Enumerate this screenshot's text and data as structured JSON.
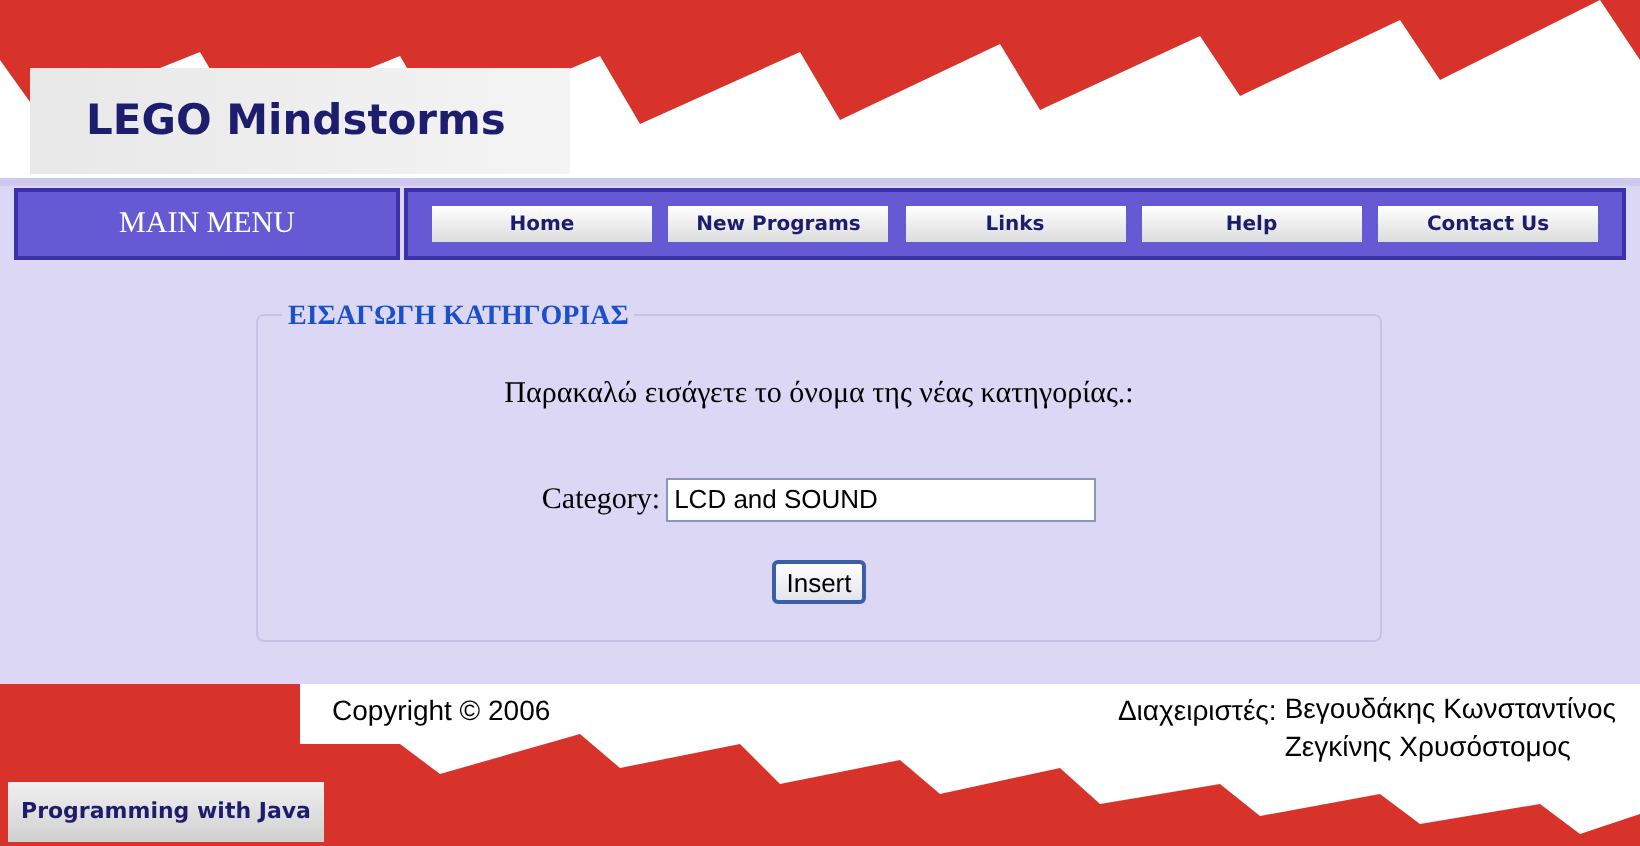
{
  "header": {
    "logo_text": "LEGO Mindstorms"
  },
  "nav": {
    "main_menu": "MAIN MENU",
    "items": [
      {
        "label": "Home"
      },
      {
        "label": "New Programs"
      },
      {
        "label": "Links"
      },
      {
        "label": "Help"
      },
      {
        "label": "Contact Us"
      }
    ]
  },
  "form": {
    "legend": "ΕΙΣΑΓΩΓΗ ΚΑΤΗΓΟΡΙΑΣ",
    "instruction": "Παρακαλώ εισάγετε το όνομα της νέας κατηγορίας.:",
    "field_label": "Category:",
    "field_value": "LCD and SOUND",
    "submit": "Insert"
  },
  "footer": {
    "copyright": "Copyright © 2006",
    "admins_label": "Διαχειριστές:",
    "admins": [
      "Βεγουδάκης Κωνσταντίνος",
      "Ζεγκίνης Χρυσόστομος"
    ],
    "badge": "Programming with Java"
  }
}
